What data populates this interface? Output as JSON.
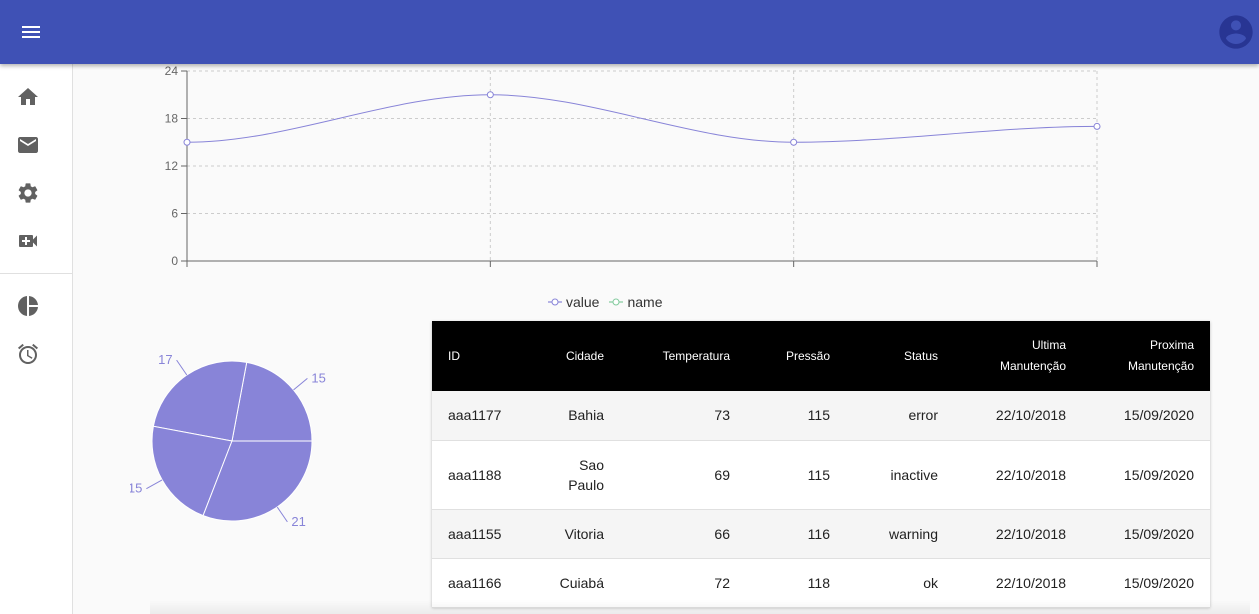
{
  "appbar": {
    "color": "#3f51b5",
    "menu_icon": "menu-icon",
    "account_icon": "account-circle-icon"
  },
  "drawer": {
    "items": [
      {
        "icon": "home-icon"
      },
      {
        "icon": "mail-icon"
      },
      {
        "icon": "settings-icon"
      },
      {
        "icon": "video-call-icon"
      }
    ],
    "secondary_items": [
      {
        "icon": "pie-chart-icon"
      },
      {
        "icon": "alarm-icon"
      }
    ]
  },
  "chart_data": [
    {
      "type": "line",
      "x": [
        0,
        1,
        2,
        3
      ],
      "series": [
        {
          "name": "value",
          "values": [
            15,
            21,
            15,
            17
          ],
          "color": "#8884d8"
        },
        {
          "name": "name",
          "values": [],
          "color": "#82ca9d"
        }
      ],
      "ylim": [
        0,
        24
      ],
      "yticks": [
        "0",
        "6",
        "12",
        "18",
        "24"
      ],
      "grid": true,
      "legend_placement": "bottom-center"
    },
    {
      "type": "pie",
      "values": [
        15,
        17,
        15,
        21
      ],
      "labels": [
        "15",
        "17",
        "15",
        "21"
      ],
      "color": "#8884d8"
    }
  ],
  "table": {
    "headers": [
      [
        "ID"
      ],
      [
        "Cidade"
      ],
      [
        "Temperatura"
      ],
      [
        "Pressão"
      ],
      [
        "Status"
      ],
      [
        "Ultima",
        "Manutenção"
      ],
      [
        "Proxima",
        "Manutenção"
      ]
    ],
    "rows": [
      [
        "aaa1177",
        "Bahia",
        "73",
        "115",
        "error",
        "22/10/2018",
        "15/09/2020"
      ],
      [
        "aaa1188",
        "Sao\nPaulo",
        "69",
        "115",
        "inactive",
        "22/10/2018",
        "15/09/2020"
      ],
      [
        "aaa1155",
        "Vitoria",
        "66",
        "116",
        "warning",
        "22/10/2018",
        "15/09/2020"
      ],
      [
        "aaa1166",
        "Cuiabá",
        "72",
        "118",
        "ok",
        "22/10/2018",
        "15/09/2020"
      ]
    ]
  }
}
